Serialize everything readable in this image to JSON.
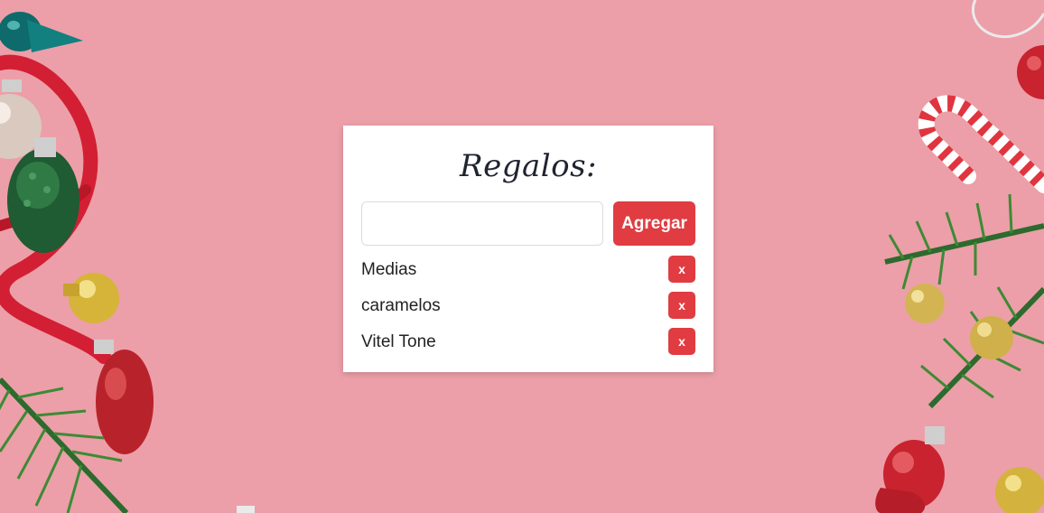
{
  "background": {
    "color": "#ec9fa8"
  },
  "card": {
    "title": "Regalos:",
    "input": {
      "value": "",
      "placeholder": ""
    },
    "add_label": "Agregar",
    "accent_color": "#e03c42",
    "gifts": [
      {
        "name": "Medias",
        "delete_label": "x"
      },
      {
        "name": "caramelos",
        "delete_label": "x"
      },
      {
        "name": "Vitel Tone",
        "delete_label": "x"
      }
    ]
  },
  "decorations": {
    "icons": [
      "ornament-icon",
      "ribbon-icon",
      "candy-cane-icon",
      "pine-branch-icon",
      "pinecone-ornament-icon",
      "gold-bauble-icon"
    ]
  }
}
